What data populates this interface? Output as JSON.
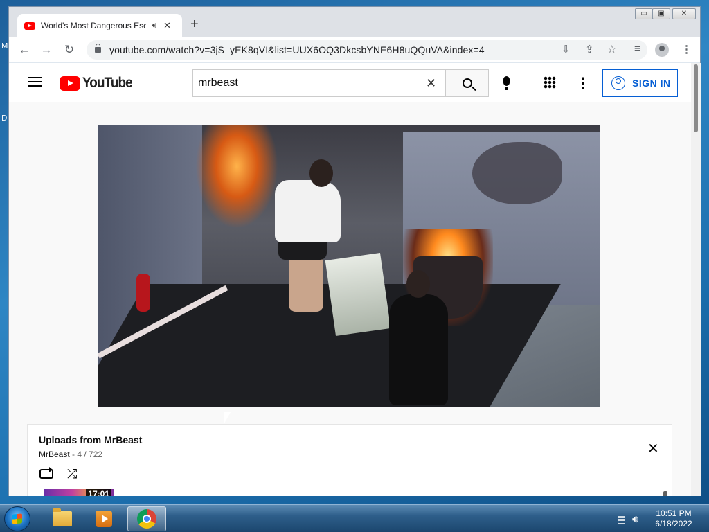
{
  "desktop": {
    "edge_text_1": "M",
    "edge_text_2": "D"
  },
  "browser": {
    "tab": {
      "title": "World's Most Dangerous Esc",
      "audio_icon": "speaker-icon"
    },
    "new_tab_label": "+",
    "window_controls": {
      "minimize": "▭",
      "restore": "▣",
      "close": "✕"
    },
    "url": "youtube.com/watch?v=3jS_yEK8qVI&list=UUX6OQ3DkcsbYNE6H8uQQuVA&index=4"
  },
  "youtube": {
    "logo_text": "YouTube",
    "search": {
      "value": "mrbeast",
      "placeholder": "Search"
    },
    "sign_in_label": "SIGN IN"
  },
  "playlist": {
    "title": "Uploads from MrBeast",
    "channel": "MrBeast",
    "separator": " - ",
    "position": "4 / 722",
    "next_item_duration": "17:01"
  },
  "taskbar": {
    "time": "10:51 PM",
    "date": "6/18/2022"
  },
  "colors": {
    "yt_red": "#ff0000",
    "link_blue": "#065fd4",
    "taskbar": "#2e5e8a"
  }
}
